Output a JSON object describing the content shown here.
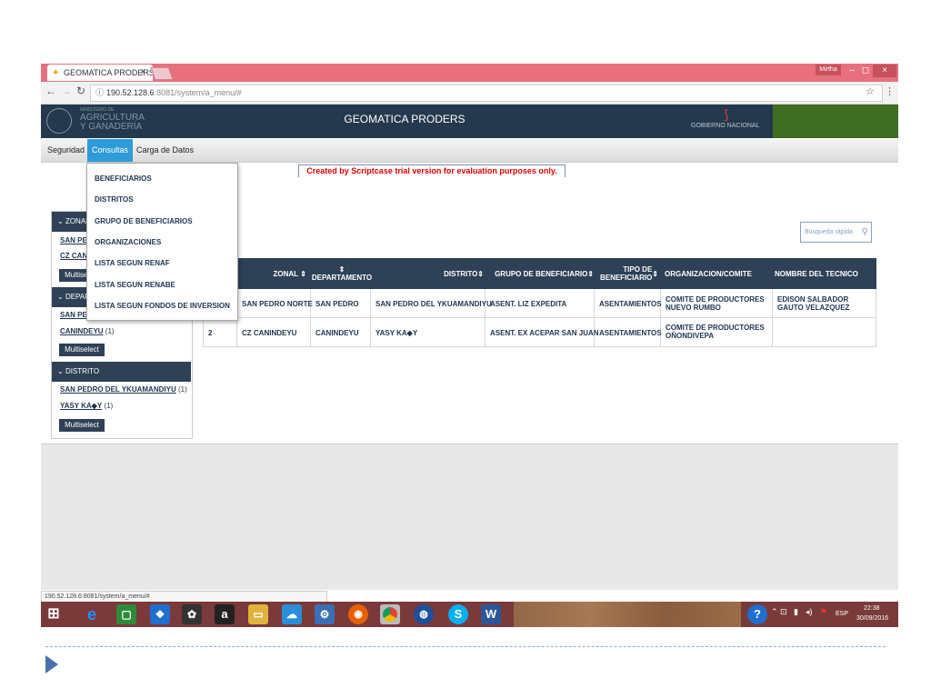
{
  "browser": {
    "tab_title": "GEOMATICA PRODERS",
    "tab_close": "×",
    "user": "Mirtha",
    "min": "–",
    "restore": "◻",
    "close": "×",
    "url": "190.52.128.6:8081/system/a_menu/#",
    "url_host": "190.52.128.6",
    "url_rest": ":8081/system/a_menu/#"
  },
  "header": {
    "title": "GEOMATICA PRODERS",
    "ministry_small": "MINISTERIO DE",
    "ministry_line1": "AGRICULTURA",
    "ministry_line2": "Y GANADERÍA",
    "gov_logo": "GOBIERNO NACIONAL"
  },
  "menu": {
    "items": [
      "Seguridad",
      "Consultas",
      "Carga de Datos"
    ],
    "dropdown": [
      "BENEFICIARIOS",
      "DISTRITOS",
      "GRUPO DE BENEFICIARIOS",
      "ORGANIZACIONES",
      "LISTA SEGUN RENAF",
      "LISTA SEGUN RENABE",
      "LISTA SEGUN FONDOS DE INVERSION"
    ]
  },
  "banner": "Created by Scriptcase trial version for evaluation purposes only.",
  "sidebar": {
    "zonal": {
      "title": "ZONAL",
      "links": [
        "SAN PEDRO NORTE",
        "CZ CANINDEYU"
      ],
      "button": "Multiselect"
    },
    "departamento": {
      "title": "DEPARTAMENTO",
      "links": [
        {
          "label": "SAN PEDRO",
          "count": ""
        },
        {
          "label": "CANINDEYU",
          "count": "(1)"
        }
      ],
      "button": "Multiselect"
    },
    "distrito": {
      "title": "DISTRITO",
      "links": [
        {
          "label": "SAN PEDRO DEL YKUAMANDIYU",
          "count": "(1)"
        },
        {
          "label": "YASY KA◆Y",
          "count": "(1)"
        }
      ],
      "button": "Multiselect"
    }
  },
  "search_placeholder": "Búsqueda rápida",
  "table": {
    "headers": [
      "ZONAL",
      "DEPARTAMENTO",
      "DISTRITO",
      "GRUPO DE BENEFICIARIO",
      "TIPO DE BENEFICIARIO",
      "ORGANIZACION/COMITE",
      "NOMBRE DEL TECNICO"
    ],
    "rows": [
      [
        "1",
        "SAN PEDRO NORTE",
        "SAN PEDRO",
        "SAN PEDRO DEL YKUAMANDIYU",
        "ASENT. LIZ EXPEDITA",
        "ASENTAMIENTOS",
        "COMITE DE PRODUCTORES NUEVO RUMBO",
        "EDISON SALBADOR GAUTO VELAZQUEZ"
      ],
      [
        "2",
        "CZ CANINDEYU",
        "CANINDEYU",
        "YASY KA◆Y",
        "ASENT. EX ACEPAR SAN JUAN",
        "ASENTAMIENTOS",
        "COMITE DE PRODUCTORES OÑONDIVEPA",
        ""
      ]
    ]
  },
  "status_url": "190.52.128.6:8081/system/a_menu/#",
  "taskbar": {
    "lang": "ESP",
    "time": "22:38",
    "date": "30/09/2016"
  }
}
